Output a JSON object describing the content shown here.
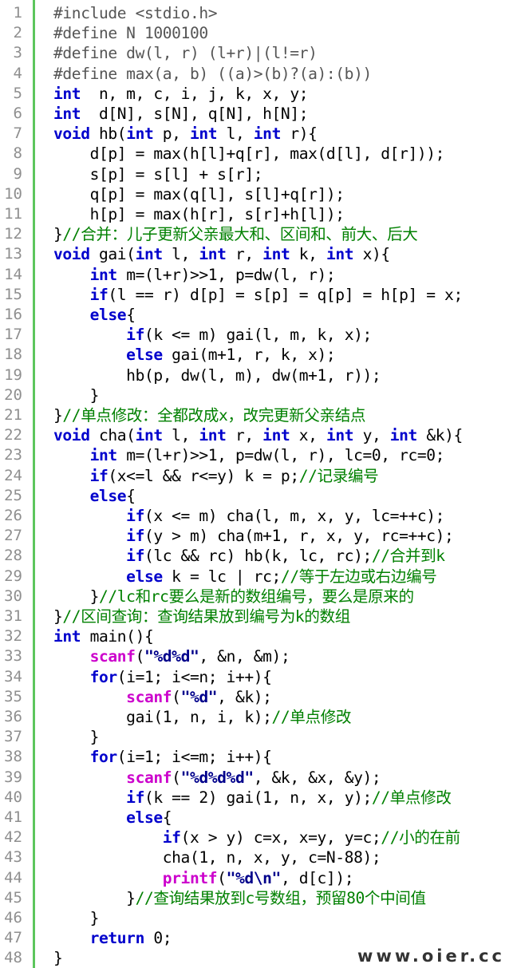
{
  "watermark": "www.oier.cc",
  "colors": {
    "gutter_bar": "#5cc65c",
    "line_number": "#8f8f8f",
    "keyword": "#0000cc",
    "function": "#cc00cc",
    "string": "#00008b",
    "comment": "#008000",
    "preprocessor": "#555555"
  },
  "lines": [
    {
      "n": "1",
      "t": [
        [
          "pp",
          "#include <stdio.h>"
        ]
      ]
    },
    {
      "n": "2",
      "t": [
        [
          "pp",
          "#define N 1000100"
        ]
      ]
    },
    {
      "n": "3",
      "t": [
        [
          "pp",
          "#define dw(l, r) (l+r)|(l!=r)"
        ]
      ]
    },
    {
      "n": "4",
      "t": [
        [
          "pp",
          "#define max(a, b) ((a)>(b)?(a):(b))"
        ]
      ]
    },
    {
      "n": "5",
      "t": [
        [
          "kw",
          "int"
        ],
        [
          "",
          "  n, m, c, i, j, k, x, y;"
        ]
      ]
    },
    {
      "n": "6",
      "t": [
        [
          "kw",
          "int"
        ],
        [
          "",
          "  d[N], s[N], q[N], h[N];"
        ]
      ]
    },
    {
      "n": "7",
      "t": [
        [
          "kw",
          "void"
        ],
        [
          "",
          " hb("
        ],
        [
          "kw",
          "int"
        ],
        [
          "",
          " p, "
        ],
        [
          "kw",
          "int"
        ],
        [
          "",
          " l, "
        ],
        [
          "kw",
          "int"
        ],
        [
          "",
          " r){"
        ]
      ]
    },
    {
      "n": "8",
      "t": [
        [
          "",
          "    d[p] = max(h[l]+q[r], max(d[l], d[r]));"
        ]
      ]
    },
    {
      "n": "9",
      "t": [
        [
          "",
          "    s[p] = s[l] + s[r];"
        ]
      ]
    },
    {
      "n": "10",
      "t": [
        [
          "",
          "    q[p] = max(q[l], s[l]+q[r]);"
        ]
      ]
    },
    {
      "n": "11",
      "t": [
        [
          "",
          "    h[p] = max(h[r], s[r]+h[l]);"
        ]
      ]
    },
    {
      "n": "12",
      "t": [
        [
          "",
          "}"
        ],
        [
          "cm",
          "//合并：儿子更新父亲最大和、区间和、前大、后大"
        ]
      ]
    },
    {
      "n": "13",
      "t": [
        [
          "kw",
          "void"
        ],
        [
          "",
          " gai("
        ],
        [
          "kw",
          "int"
        ],
        [
          "",
          " l, "
        ],
        [
          "kw",
          "int"
        ],
        [
          "",
          " r, "
        ],
        [
          "kw",
          "int"
        ],
        [
          "",
          " k, "
        ],
        [
          "kw",
          "int"
        ],
        [
          "",
          " x){"
        ]
      ]
    },
    {
      "n": "14",
      "t": [
        [
          "",
          "    "
        ],
        [
          "kw",
          "int"
        ],
        [
          "",
          " m=(l+r)>>1, p=dw(l, r);"
        ]
      ]
    },
    {
      "n": "15",
      "t": [
        [
          "",
          "    "
        ],
        [
          "kw",
          "if"
        ],
        [
          "",
          "(l == r) d[p] = s[p] = q[p] = h[p] = x;"
        ]
      ]
    },
    {
      "n": "16",
      "t": [
        [
          "",
          "    "
        ],
        [
          "kw",
          "else"
        ],
        [
          "",
          "{"
        ]
      ]
    },
    {
      "n": "17",
      "t": [
        [
          "",
          "        "
        ],
        [
          "kw",
          "if"
        ],
        [
          "",
          "(k <= m) gai(l, m, k, x);"
        ]
      ]
    },
    {
      "n": "18",
      "t": [
        [
          "",
          "        "
        ],
        [
          "kw",
          "else"
        ],
        [
          "",
          " gai(m+1, r, k, x);"
        ]
      ]
    },
    {
      "n": "19",
      "t": [
        [
          "",
          "        hb(p, dw(l, m), dw(m+1, r));"
        ]
      ]
    },
    {
      "n": "20",
      "t": [
        [
          "",
          "    }"
        ]
      ]
    },
    {
      "n": "21",
      "t": [
        [
          "",
          "}"
        ],
        [
          "cm",
          "//单点修改：全都改成x，改完更新父亲结点"
        ]
      ]
    },
    {
      "n": "22",
      "t": [
        [
          "kw",
          "void"
        ],
        [
          "",
          " cha("
        ],
        [
          "kw",
          "int"
        ],
        [
          "",
          " l, "
        ],
        [
          "kw",
          "int"
        ],
        [
          "",
          " r, "
        ],
        [
          "kw",
          "int"
        ],
        [
          "",
          " x, "
        ],
        [
          "kw",
          "int"
        ],
        [
          "",
          " y, "
        ],
        [
          "kw",
          "int"
        ],
        [
          "",
          " &k){"
        ]
      ]
    },
    {
      "n": "23",
      "t": [
        [
          "",
          "    "
        ],
        [
          "kw",
          "int"
        ],
        [
          "",
          " m=(l+r)>>1, p=dw(l, r), lc=0, rc=0;"
        ]
      ]
    },
    {
      "n": "24",
      "t": [
        [
          "",
          "    "
        ],
        [
          "kw",
          "if"
        ],
        [
          "",
          "(x<=l && r<=y) k = p;"
        ],
        [
          "cm",
          "//记录编号"
        ]
      ]
    },
    {
      "n": "25",
      "t": [
        [
          "",
          "    "
        ],
        [
          "kw",
          "else"
        ],
        [
          "",
          "{"
        ]
      ]
    },
    {
      "n": "26",
      "t": [
        [
          "",
          "        "
        ],
        [
          "kw",
          "if"
        ],
        [
          "",
          "(x <= m) cha(l, m, x, y, lc=++c);"
        ]
      ]
    },
    {
      "n": "27",
      "t": [
        [
          "",
          "        "
        ],
        [
          "kw",
          "if"
        ],
        [
          "",
          "(y > m) cha(m+1, r, x, y, rc=++c);"
        ]
      ]
    },
    {
      "n": "28",
      "t": [
        [
          "",
          "        "
        ],
        [
          "kw",
          "if"
        ],
        [
          "",
          "(lc && rc) hb(k, lc, rc);"
        ],
        [
          "cm",
          "//合并到k"
        ]
      ]
    },
    {
      "n": "29",
      "t": [
        [
          "",
          "        "
        ],
        [
          "kw",
          "else"
        ],
        [
          "",
          " k = lc | rc;"
        ],
        [
          "cm",
          "//等于左边或右边编号"
        ]
      ]
    },
    {
      "n": "30",
      "t": [
        [
          "",
          "    }"
        ],
        [
          "cm",
          "//lc和rc要么是新的数组编号，要么是原来的"
        ]
      ]
    },
    {
      "n": "31",
      "t": [
        [
          "",
          "}"
        ],
        [
          "cm",
          "//区间查询：查询结果放到编号为k的数组"
        ]
      ]
    },
    {
      "n": "32",
      "t": [
        [
          "kw",
          "int"
        ],
        [
          "",
          " main(){"
        ]
      ]
    },
    {
      "n": "33",
      "t": [
        [
          "",
          "    "
        ],
        [
          "fn",
          "scanf"
        ],
        [
          "",
          "("
        ],
        [
          "str",
          "\"%d%d\""
        ],
        [
          "",
          ", &n, &m);"
        ]
      ]
    },
    {
      "n": "34",
      "t": [
        [
          "",
          "    "
        ],
        [
          "kw",
          "for"
        ],
        [
          "",
          "(i=1; i<=n; i++){"
        ]
      ]
    },
    {
      "n": "35",
      "t": [
        [
          "",
          "        "
        ],
        [
          "fn",
          "scanf"
        ],
        [
          "",
          "("
        ],
        [
          "str",
          "\"%d\""
        ],
        [
          "",
          ", &k);"
        ]
      ]
    },
    {
      "n": "36",
      "t": [
        [
          "",
          "        gai(1, n, i, k);"
        ],
        [
          "cm",
          "//单点修改"
        ]
      ]
    },
    {
      "n": "37",
      "t": [
        [
          "",
          "    }"
        ]
      ]
    },
    {
      "n": "38",
      "t": [
        [
          "",
          "    "
        ],
        [
          "kw",
          "for"
        ],
        [
          "",
          "(i=1; i<=m; i++){"
        ]
      ]
    },
    {
      "n": "39",
      "t": [
        [
          "",
          "        "
        ],
        [
          "fn",
          "scanf"
        ],
        [
          "",
          "("
        ],
        [
          "str",
          "\"%d%d%d\""
        ],
        [
          "",
          ", &k, &x, &y);"
        ]
      ]
    },
    {
      "n": "40",
      "t": [
        [
          "",
          "        "
        ],
        [
          "kw",
          "if"
        ],
        [
          "",
          "(k == 2) gai(1, n, x, y);"
        ],
        [
          "cm",
          "//单点修改"
        ]
      ]
    },
    {
      "n": "41",
      "t": [
        [
          "",
          "        "
        ],
        [
          "kw",
          "else"
        ],
        [
          "",
          "{"
        ]
      ]
    },
    {
      "n": "42",
      "t": [
        [
          "",
          "            "
        ],
        [
          "kw",
          "if"
        ],
        [
          "",
          "(x > y) c=x, x=y, y=c;"
        ],
        [
          "cm",
          "//小的在前"
        ]
      ]
    },
    {
      "n": "43",
      "t": [
        [
          "",
          "            cha(1, n, x, y, c=N-88);"
        ]
      ]
    },
    {
      "n": "44",
      "t": [
        [
          "",
          "            "
        ],
        [
          "fn",
          "printf"
        ],
        [
          "",
          "("
        ],
        [
          "str",
          "\"%d\\n\""
        ],
        [
          "",
          ", d[c]);"
        ]
      ]
    },
    {
      "n": "45",
      "t": [
        [
          "",
          "        }"
        ],
        [
          "cm",
          "//查询结果放到c号数组，预留80个中间值"
        ]
      ]
    },
    {
      "n": "46",
      "t": [
        [
          "",
          "    }"
        ]
      ]
    },
    {
      "n": "47",
      "t": [
        [
          "",
          "    "
        ],
        [
          "kw",
          "return"
        ],
        [
          "",
          " 0;"
        ]
      ]
    },
    {
      "n": "48",
      "t": [
        [
          "",
          "}"
        ]
      ]
    }
  ]
}
